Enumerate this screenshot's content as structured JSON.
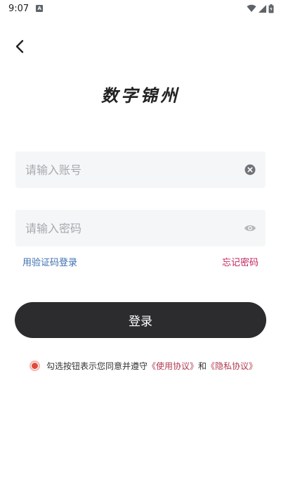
{
  "status_bar": {
    "time": "9:07",
    "notification_icon_letter": "A",
    "icons": [
      "wifi-icon",
      "cell-signal-icon",
      "battery-icon"
    ]
  },
  "nav": {
    "back_icon": "chevron-left-icon"
  },
  "app_title": "数字锦州",
  "account_field": {
    "placeholder": "请输入账号",
    "value": "",
    "clear_icon": "clear-circle-icon"
  },
  "password_field": {
    "placeholder": "请输入密码",
    "value": "",
    "visibility_icon": "eye-icon"
  },
  "links": {
    "sms_login": "用验证码登录",
    "forgot_password": "忘记密码"
  },
  "login_button": {
    "label": "登录"
  },
  "agreement": {
    "prefix": "勾选按钮表示您同意并遵守",
    "terms_link": "《使用协议》",
    "and": "和",
    "privacy_link": "《隐私协议》",
    "checked": true
  },
  "colors": {
    "button_bg": "#2c2c2e",
    "field_bg": "#f5f6f8",
    "sms_link": "#3e6fb0",
    "forgot_link": "#c2245c",
    "radio_accent": "#e24a3a"
  }
}
